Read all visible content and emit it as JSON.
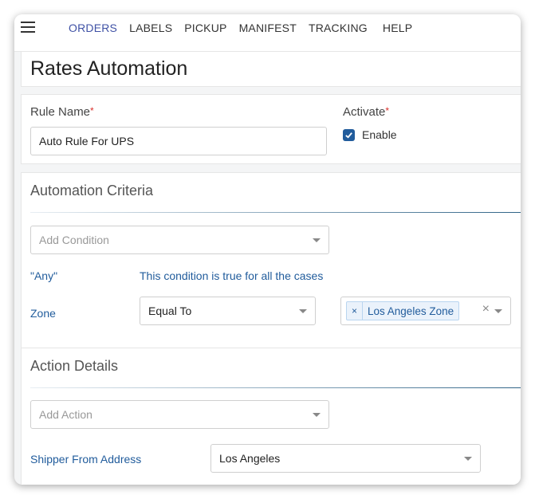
{
  "nav": {
    "items": [
      {
        "label": "ORDERS",
        "active": true
      },
      {
        "label": "LABELS",
        "active": false
      },
      {
        "label": "PICKUP",
        "active": false
      },
      {
        "label": "MANIFEST",
        "active": false
      },
      {
        "label": "TRACKING",
        "active": false
      },
      {
        "label": "HELP",
        "active": false
      }
    ]
  },
  "page": {
    "title": "Rates Automation"
  },
  "rule": {
    "name_label": "Rule Name",
    "name_value": "Auto Rule For UPS",
    "required_mark": "*",
    "activate_label": "Activate",
    "enable_label": "Enable",
    "enabled": true
  },
  "criteria": {
    "title": "Automation Criteria",
    "add_condition_placeholder": "Add Condition",
    "any_label": "\"Any\"",
    "any_description": "This condition is true for all the cases",
    "zone_label": "Zone",
    "operator_value": "Equal To",
    "zone_tags": [
      "Los Angeles Zone"
    ],
    "tag_remove": "×",
    "clear": "×"
  },
  "action": {
    "title": "Action Details",
    "add_action_placeholder": "Add Action",
    "shipper_label": "Shipper From Address",
    "shipper_value": "Los Angeles"
  },
  "colors": {
    "accent": "#215c9c",
    "active_nav": "#3f51a5",
    "required": "#d9302b"
  }
}
